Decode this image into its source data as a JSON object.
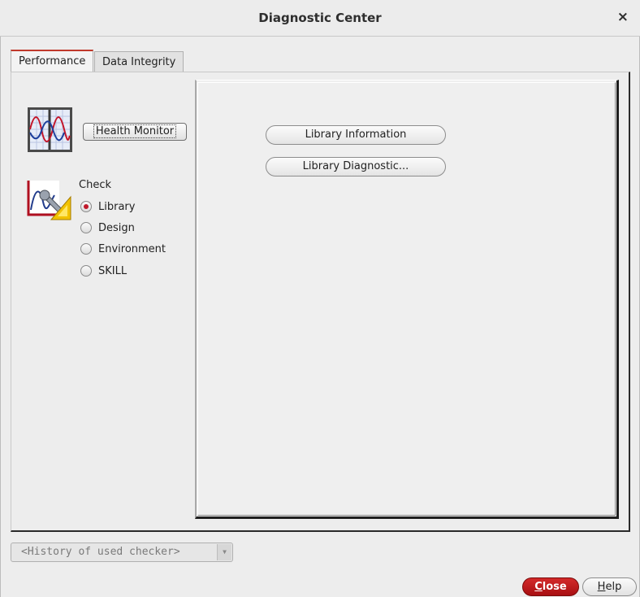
{
  "window": {
    "title": "Diagnostic Center",
    "close_glyph": "×"
  },
  "tabs": [
    {
      "label": "Performance",
      "active": true
    },
    {
      "label": "Data Integrity",
      "active": false
    }
  ],
  "left": {
    "health_monitor_label": "Health Monitor",
    "check_label": "Check",
    "check_options": [
      {
        "label": "Library",
        "selected": true
      },
      {
        "label": "Design",
        "selected": false
      },
      {
        "label": "Environment",
        "selected": false
      },
      {
        "label": "SKILL",
        "selected": false
      }
    ],
    "icons": [
      "waveform-monitor-icon",
      "diagnostic-tools-icon"
    ]
  },
  "right": {
    "buttons": [
      {
        "label": "Library Information"
      },
      {
        "label": "Library Diagnostic..."
      }
    ]
  },
  "history": {
    "value": "<History of used checker>",
    "arrow_glyph": "▼"
  },
  "footer": {
    "close_first": "C",
    "close_rest": "lose",
    "help_first": "H",
    "help_rest": "elp"
  },
  "colors": {
    "accent": "#c0392b",
    "close_button": "#c0192b"
  }
}
